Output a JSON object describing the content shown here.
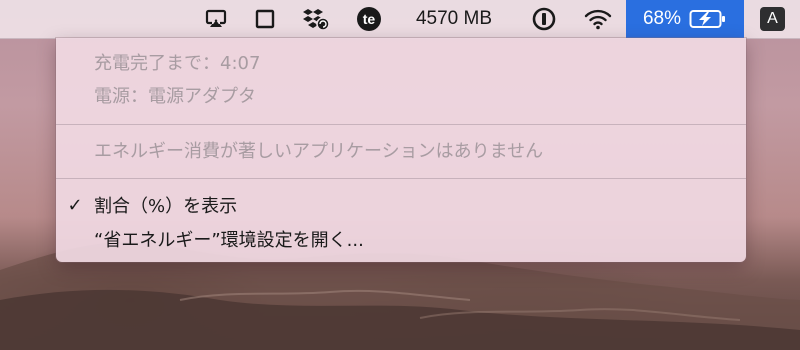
{
  "menubar": {
    "memory_text": "4570 MB",
    "battery_percent_text": "68%",
    "input_source_label": "A",
    "icons": [
      "airplay-icon",
      "window-icon",
      "dropbox-icon",
      "te-app-icon",
      "onepassword-icon",
      "wifi-icon",
      "battery-charging-icon"
    ]
  },
  "battery_menu": {
    "status_time": "充電完了まで：4:07",
    "power_source": "電源：電源アダプタ",
    "energy_message": "エネルギー消費が著しいアプリケーションはありません",
    "show_percent_label": "割合（%）を表示",
    "show_percent_checked": true,
    "open_prefs_label": "“省エネルギー”環境設定を開く..."
  },
  "colors": {
    "accent": "#2a6fe0",
    "menu_background": "#f0d8e2",
    "disabled_text": "#a89ca2"
  }
}
